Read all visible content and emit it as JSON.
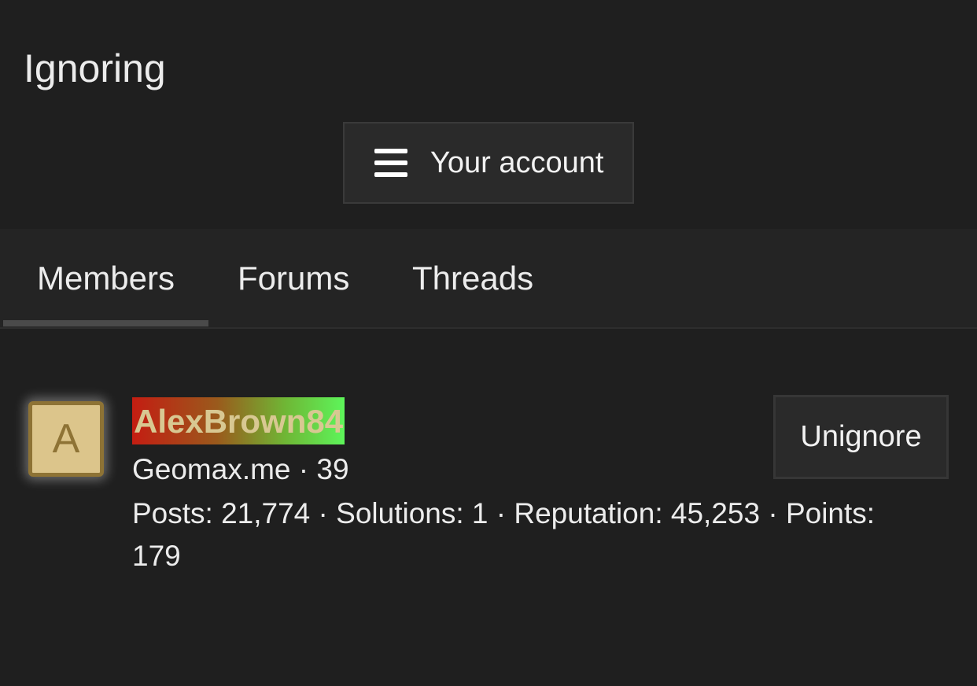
{
  "page": {
    "title": "Ignoring"
  },
  "account_menu": {
    "icon": "hamburger-icon",
    "label": "Your account"
  },
  "tabs": [
    {
      "label": "Members",
      "active": true
    },
    {
      "label": "Forums",
      "active": false
    },
    {
      "label": "Threads",
      "active": false
    }
  ],
  "members": [
    {
      "avatar_letter": "A",
      "username": "AlexBrown84",
      "subtitle": "Geomax.me · 39",
      "stats": "Posts: 21,774 · Solutions: 1 · Reputation: 45,253 · Points: 179",
      "action_label": "Unignore"
    }
  ],
  "colors": {
    "background": "#1f1f1f",
    "button_bg": "#2a2a2a",
    "avatar_bg": "#dcc58b",
    "avatar_border": "#8e7335",
    "username_text": "#d8c892"
  }
}
